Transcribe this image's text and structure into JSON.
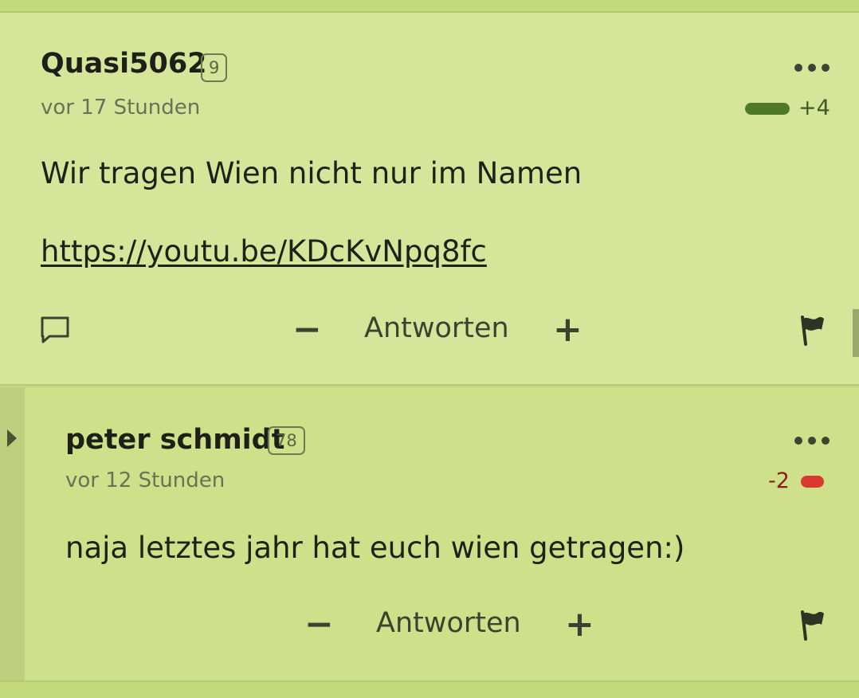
{
  "posts": [
    {
      "username": "Quasi5062",
      "badge": "9",
      "time": "vor 17 Stunden",
      "score": "+4",
      "rating": 1.0,
      "body_text": "Wir tragen Wien nicht nur im Namen",
      "link": "https://youtu.be/KDcKvNpq8fc",
      "reply_label": "Antworten",
      "minus_label": "−",
      "plus_label": "+"
    },
    {
      "username": "peter schmidt",
      "badge": "78",
      "time": "vor 12 Stunden",
      "score": "-2",
      "rating": -1.0,
      "body_text": "naja letztes jahr hat euch wien getragen:)",
      "reply_label": "Antworten",
      "minus_label": "−",
      "plus_label": "+"
    }
  ],
  "colors": {
    "post_bg": "#d7e59b",
    "reply_bg": "#cfe08a",
    "positive": "#4e7a28",
    "negative": "#d93a2f"
  },
  "icons": [
    "more-options-icon",
    "comment-icon",
    "flag-icon",
    "expand-thread-icon"
  ]
}
